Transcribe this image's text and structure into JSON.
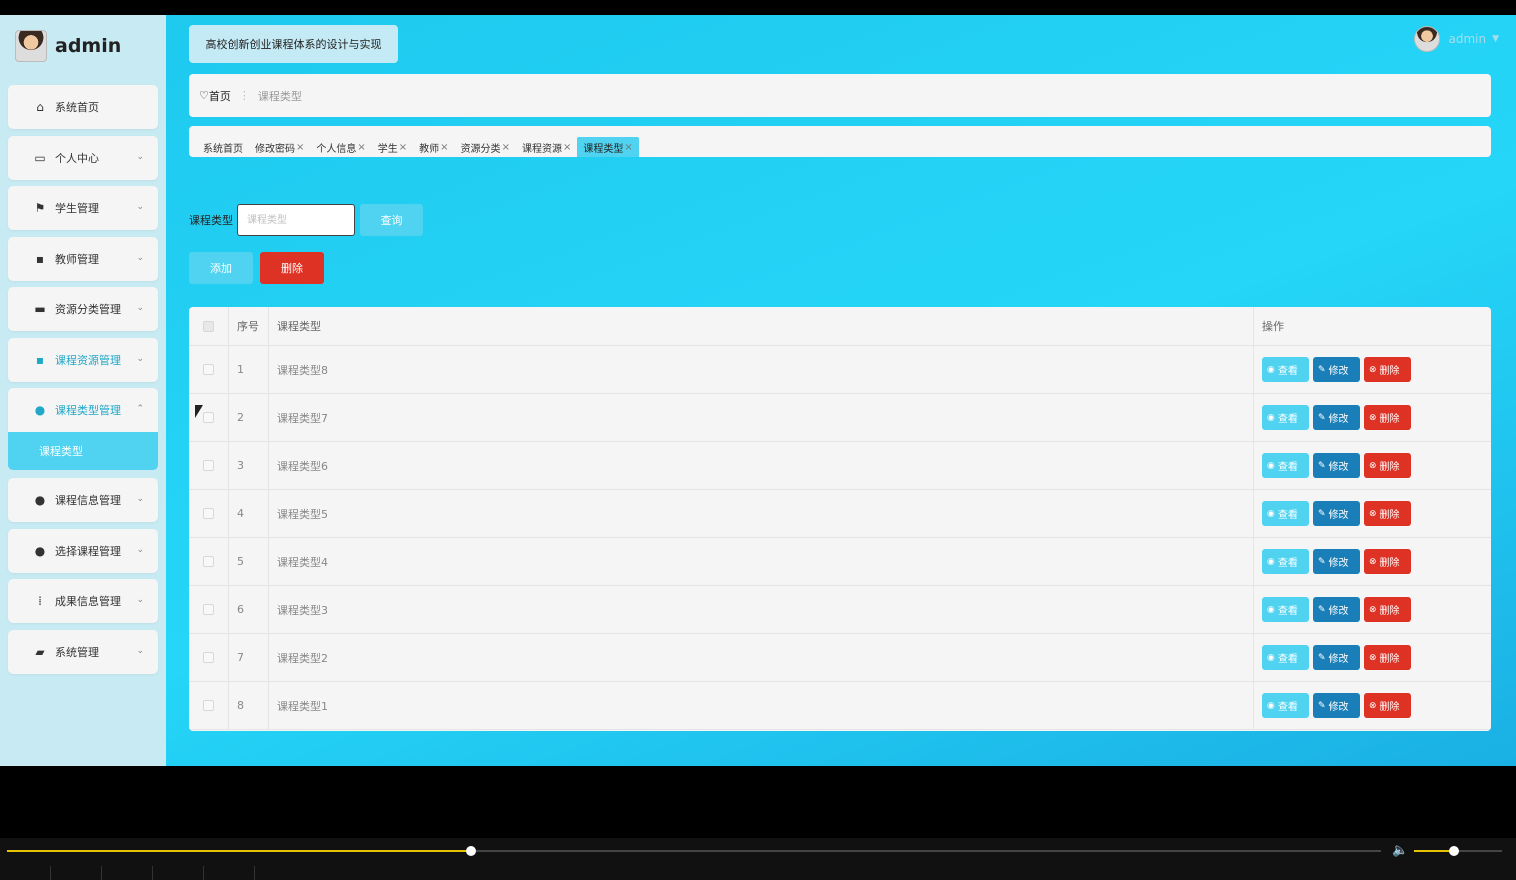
{
  "app": {
    "brand_name": "admin",
    "system_title": "高校创新创业课程体系的设计与实现",
    "user_name": "admin"
  },
  "sidebar": {
    "items": [
      {
        "label": "系统首页",
        "icon": "home-icon"
      },
      {
        "label": "个人中心",
        "icon": "profile-card-icon"
      },
      {
        "label": "学生管理",
        "icon": "flag-icon"
      },
      {
        "label": "教师管理",
        "icon": "grid-icon"
      },
      {
        "label": "资源分类管理",
        "icon": "briefcase-icon"
      },
      {
        "label": "课程资源管理",
        "icon": "grid-icon"
      },
      {
        "label": "课程类型管理",
        "icon": "user-icon"
      },
      {
        "label": "课程信息管理",
        "icon": "user-icon"
      },
      {
        "label": "选择课程管理",
        "icon": "lightbulb-icon"
      },
      {
        "label": "成果信息管理",
        "icon": "apps-icon"
      },
      {
        "label": "系统管理",
        "icon": "ticket-icon"
      }
    ],
    "active_sub_item": "课程类型"
  },
  "breadcrumb": {
    "home": "首页",
    "separator": "⋮",
    "current": "课程类型"
  },
  "tabs": [
    {
      "label": "系统首页",
      "closable": false
    },
    {
      "label": "修改密码",
      "closable": true
    },
    {
      "label": "个人信息",
      "closable": true
    },
    {
      "label": "学生",
      "closable": true
    },
    {
      "label": "教师",
      "closable": true
    },
    {
      "label": "资源分类",
      "closable": true
    },
    {
      "label": "课程资源",
      "closable": true
    },
    {
      "label": "课程类型",
      "closable": true,
      "active": true
    }
  ],
  "search": {
    "label": "课程类型",
    "placeholder": "课程类型",
    "button": "查询"
  },
  "toolbar": {
    "add_label": "添加",
    "delete_label": "删除"
  },
  "table": {
    "columns": {
      "no": "序号",
      "name": "课程类型",
      "ops": "操作"
    },
    "rows": [
      {
        "no": "1",
        "name": "课程类型8"
      },
      {
        "no": "2",
        "name": "课程类型7"
      },
      {
        "no": "3",
        "name": "课程类型6"
      },
      {
        "no": "4",
        "name": "课程类型5"
      },
      {
        "no": "5",
        "name": "课程类型4"
      },
      {
        "no": "6",
        "name": "课程类型3"
      },
      {
        "no": "7",
        "name": "课程类型2"
      },
      {
        "no": "8",
        "name": "课程类型1"
      }
    ],
    "actions": {
      "view": "查看",
      "edit": "修改",
      "delete": "删除"
    }
  },
  "colors": {
    "accent": "#4fd3f0",
    "edit": "#1a7fb8",
    "danger": "#de3225",
    "sidebar_bg": "#c7eaf3"
  },
  "player": {
    "progress": 0.338,
    "volume": 0.45
  }
}
